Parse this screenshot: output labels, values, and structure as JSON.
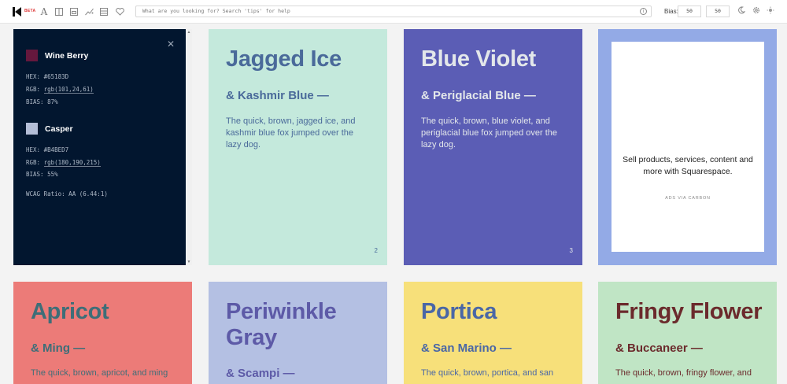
{
  "toolbar": {
    "beta_badge": "BETA",
    "search_placeholder": "What are you looking for? Search 'tips' for help",
    "bias_label": "Bias:",
    "bias_left": "50",
    "bias_right": "50"
  },
  "info_panel": {
    "color1": {
      "name": "Wine Berry",
      "hex": "HEX: #65183D",
      "rgb_prefix": "RGB: ",
      "rgb": "rgb(101,24,61)",
      "bias": "BIAS: 87%",
      "swatch": "#65183D"
    },
    "color2": {
      "name": "Casper",
      "hex": "HEX: #B4BED7",
      "rgb_prefix": "RGB: ",
      "rgb": "rgb(180,190,215)",
      "bias": "BIAS: 55%",
      "swatch": "#B4BED7"
    },
    "wcag": "WCAG Ratio: AA (6.44:1)"
  },
  "cards": [
    {
      "title": "Jagged Ice",
      "subtitle": "& Kashmir Blue —",
      "description": "The quick, brown, jagged ice, and kashmir blue fox jumped over the lazy dog.",
      "number": "2",
      "bg": "#c4e9dc",
      "fg": "#4a6a9a"
    },
    {
      "title": "Blue Violet",
      "subtitle": "& Periglacial Blue —",
      "description": "The quick, brown, blue violet, and periglacial blue fox jumped over the lazy dog.",
      "number": "3",
      "bg": "#5b5db5",
      "fg": "#e3e7ea"
    },
    {
      "title": "Apricot",
      "subtitle": "& Ming —",
      "description": "The quick, brown, apricot, and ming",
      "bg": "#ec7b78",
      "fg": "#3e6e78"
    },
    {
      "title": "Periwinkle Gray",
      "subtitle": "& Scampi —",
      "description": "",
      "bg": "#b4c0e3",
      "fg": "#5d5aa7"
    },
    {
      "title": "Portica",
      "subtitle": "& San Marino —",
      "description": "The quick, brown, portica, and san",
      "bg": "#f7e07a",
      "fg": "#4a67a6"
    },
    {
      "title": "Fringy Flower",
      "subtitle": "& Buccaneer —",
      "description": "The quick, brown, fringy flower, and",
      "bg": "#c0e5c5",
      "fg": "#6b2a2c"
    }
  ],
  "ad": {
    "text": "Sell products, services, content and more with Squarespace.",
    "via": "ADS VIA CARBON"
  }
}
